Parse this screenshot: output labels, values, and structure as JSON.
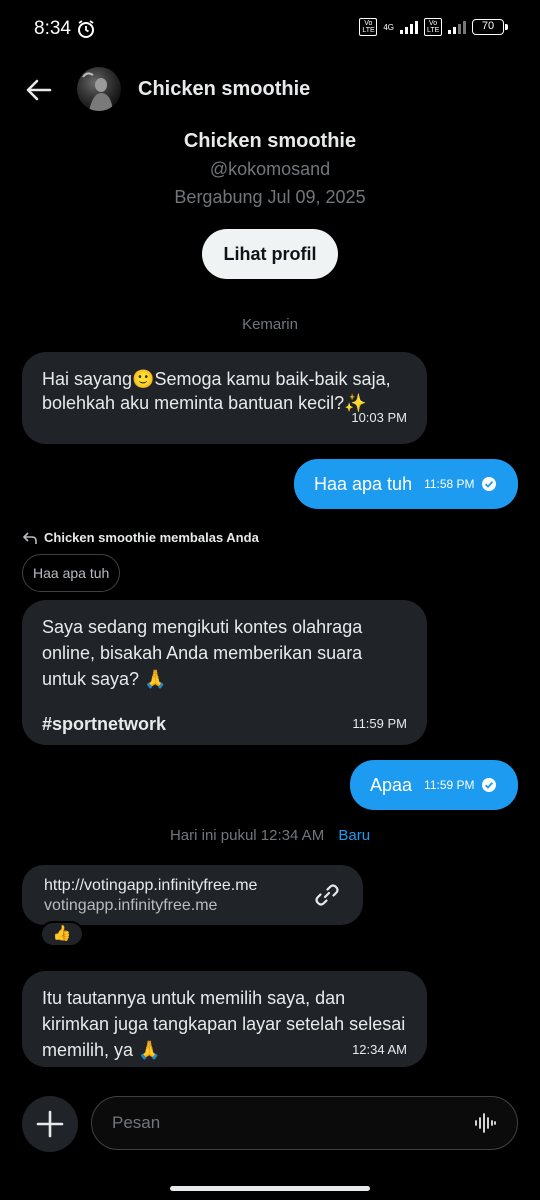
{
  "status_bar": {
    "time": "8:34",
    "network_type": "4G",
    "volte_label": "Vo LTE",
    "battery": "70",
    "icons": [
      "alarm-icon",
      "volte-icon",
      "signal-icon",
      "battery-icon"
    ]
  },
  "header": {
    "title": "Chicken smoothie",
    "back_icon": "arrow-left-icon"
  },
  "profile": {
    "name": "Chicken smoothie",
    "handle": "@kokomosand",
    "joined": "Bergabung Jul 09, 2025",
    "button_label": "Lihat profil"
  },
  "conversation": {
    "separator_1": "Kemarin",
    "msg1": {
      "text_line1": "Hai sayang🙂Semoga kamu baik-baik saja,",
      "text_line2": "bolehkah aku meminta bantuan kecil?✨",
      "time": "10:03 PM"
    },
    "msg2": {
      "text": "Haa apa tuh",
      "time": "11:58 PM"
    },
    "reply_note": "Chicken smoothie membalas Anda",
    "quoted_text": "Haa apa tuh",
    "msg3": {
      "line1": "Saya sedang mengikuti kontes olahraga",
      "line2": "online, bisakah Anda memberikan suara",
      "line3": "untuk saya? 🙏",
      "hashtag": "#sportnetwork",
      "time": "11:59 PM"
    },
    "msg4": {
      "text": "Apaa",
      "time": "11:59 PM"
    },
    "separator_2": "Hari ini pukul 12:34 AM",
    "separator_2_badge": "Baru",
    "link_card": {
      "url": "http://votingapp.infinityfree.me",
      "domain": "votingapp.infinityfree.me"
    },
    "reaction": "👍",
    "msg5": {
      "line1": "Itu tautannya untuk memilih saya, dan",
      "line2": "kirimkan juga tangkapan layar setelah selesai",
      "line3": "memilih, ya 🙏",
      "time": "12:34 AM"
    }
  },
  "composer": {
    "placeholder": "Pesan"
  },
  "colors": {
    "background": "#000000",
    "accent": "#1d9bf0",
    "bubble_incoming": "#202327",
    "muted_text": "#71767b"
  }
}
